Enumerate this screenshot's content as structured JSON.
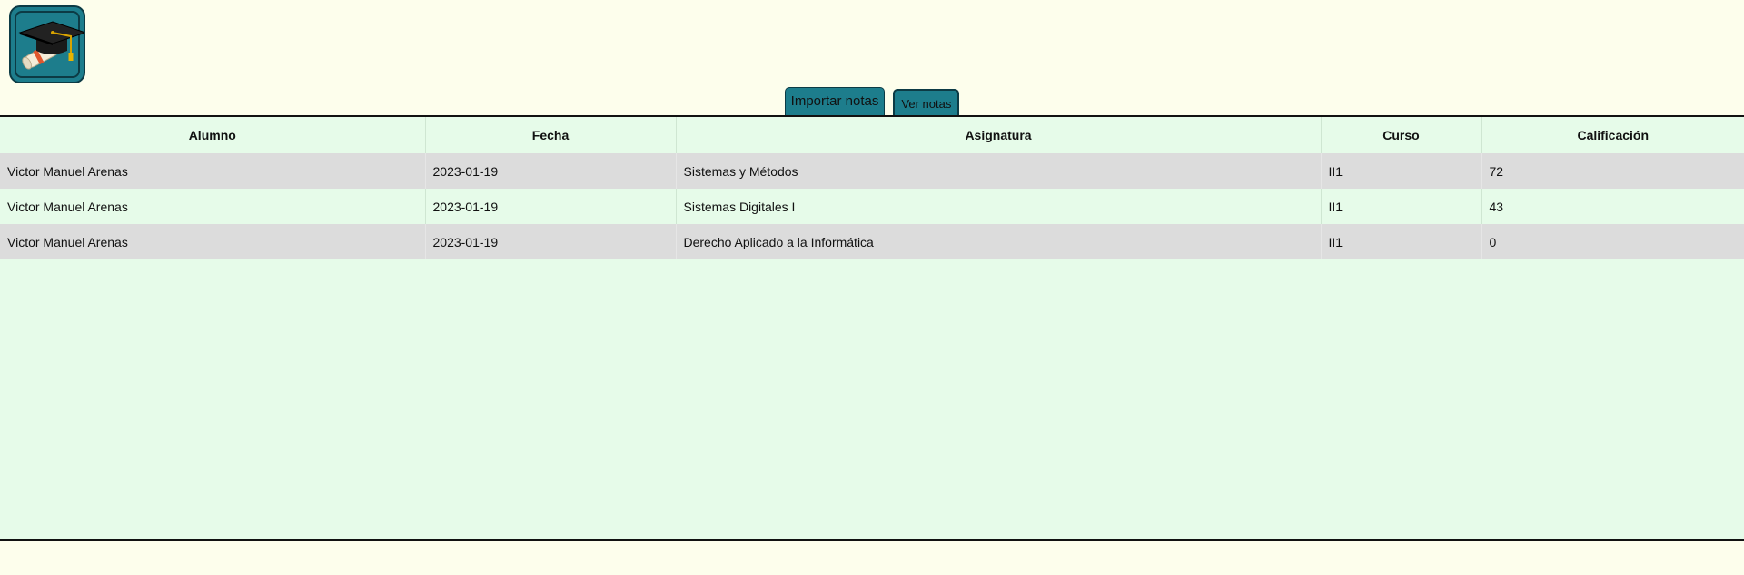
{
  "logo": {
    "icon": "graduation-cap-icon"
  },
  "tabs": [
    {
      "label": "Importar notas"
    },
    {
      "label": "Ver notas"
    }
  ],
  "table": {
    "headers": [
      "Alumno",
      "Fecha",
      "Asignatura",
      "Curso",
      "Calificación"
    ],
    "rows": [
      [
        "Victor Manuel Arenas",
        "2023-01-19",
        "Sistemas y Métodos",
        "II1",
        "72"
      ],
      [
        "Victor Manuel Arenas",
        "2023-01-19",
        "Sistemas Digitales I",
        "II1",
        "43"
      ],
      [
        "Victor Manuel Arenas",
        "2023-01-19",
        "Derecho Aplicado a la Informática",
        "II1",
        "0"
      ]
    ]
  },
  "colors": {
    "page_background": "#fdfeec",
    "panel_background": "#e6fbe9",
    "accent": "#1d7d8c",
    "row_alt": "#dcdcdc"
  }
}
